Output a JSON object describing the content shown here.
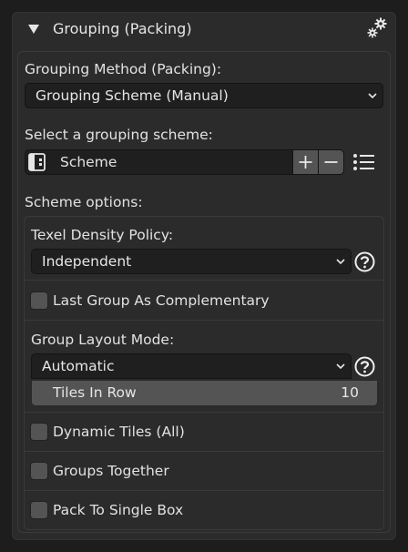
{
  "panel": {
    "title": "Grouping (Packing)",
    "header_icon": "settings-gears-icon"
  },
  "grouping_method": {
    "label": "Grouping Method (Packing):",
    "value": "Grouping Scheme (Manual)"
  },
  "scheme_select": {
    "label": "Select a grouping scheme:",
    "icon": "scheme-browse-icon",
    "value": "Scheme",
    "add_icon": "plus-icon",
    "remove_icon": "minus-icon",
    "list_icon": "list-icon"
  },
  "scheme_options": {
    "label": "Scheme options:",
    "texel_density": {
      "label": "Texel Density Policy:",
      "value": "Independent"
    },
    "last_group_complementary": {
      "label": "Last Group As Complementary",
      "checked": false
    },
    "group_layout": {
      "label": "Group Layout Mode:",
      "value": "Automatic",
      "tiles_in_row": {
        "label": "Tiles In Row",
        "value": "10"
      }
    },
    "dynamic_tiles": {
      "label": "Dynamic Tiles (All)",
      "checked": false
    },
    "groups_together": {
      "label": "Groups Together",
      "checked": false
    },
    "pack_single_box": {
      "label": "Pack To Single Box",
      "checked": false
    }
  },
  "colors": {
    "background": "#1d1d1d",
    "panel": "#2b2b2b",
    "field": "#1f1f1f",
    "button": "#545454",
    "text": "#e2e2e2"
  }
}
